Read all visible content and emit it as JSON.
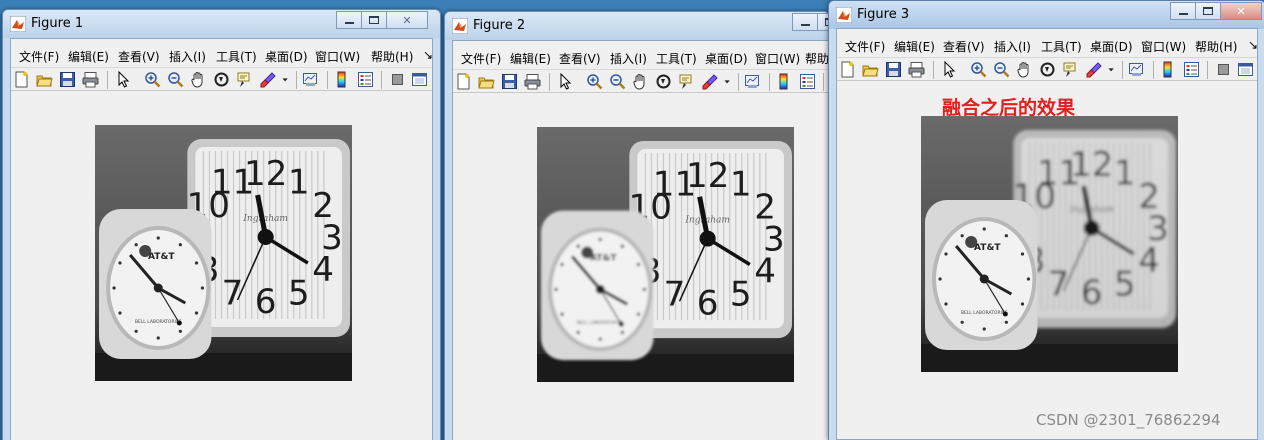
{
  "figures": [
    {
      "title": "Figure 1",
      "menu": [
        "文件(F)",
        "编辑(E)",
        "查看(V)",
        "插入(I)",
        "工具(T)",
        "桌面(D)",
        "窗口(W)",
        "帮助(H)",
        "↘"
      ],
      "image_label": ""
    },
    {
      "title": "Figure 2",
      "menu": [
        "文件(F)",
        "编辑(E)",
        "查看(V)",
        "插入(I)",
        "工具(T)",
        "桌面(D)",
        "窗口(W)",
        "帮助"
      ],
      "image_label": ""
    },
    {
      "title": "Figure 3",
      "menu": [
        "文件(F)",
        "编辑(E)",
        "查看(V)",
        "插入(I)",
        "工具(T)",
        "桌面(D)",
        "窗口(W)",
        "帮助(H)",
        "↘"
      ],
      "image_label": "融合之后的效果"
    }
  ],
  "clock_text": {
    "small_clock_brand": "AT&T",
    "small_clock_sub": "BELL LABORATORIES",
    "big_clock_brand": "Ingraham",
    "hours": [
      "12",
      "1",
      "2",
      "3",
      "4",
      "5",
      "6",
      "7",
      "8",
      "9",
      "10",
      "11"
    ]
  },
  "toolbar_icons": [
    "new-file-icon",
    "open-folder-icon",
    "save-icon",
    "print-icon",
    "pointer-icon",
    "zoom-in-icon",
    "zoom-out-icon",
    "pan-hand-icon",
    "rotate-3d-icon",
    "data-cursor-icon",
    "brush-icon",
    "brush-dropdown-icon",
    "link-plot-icon",
    "colorbar-icon",
    "legend-icon",
    "hide-plot-tools-icon",
    "show-plot-tools-icon"
  ],
  "watermark": "CSDN @2301_76862294"
}
